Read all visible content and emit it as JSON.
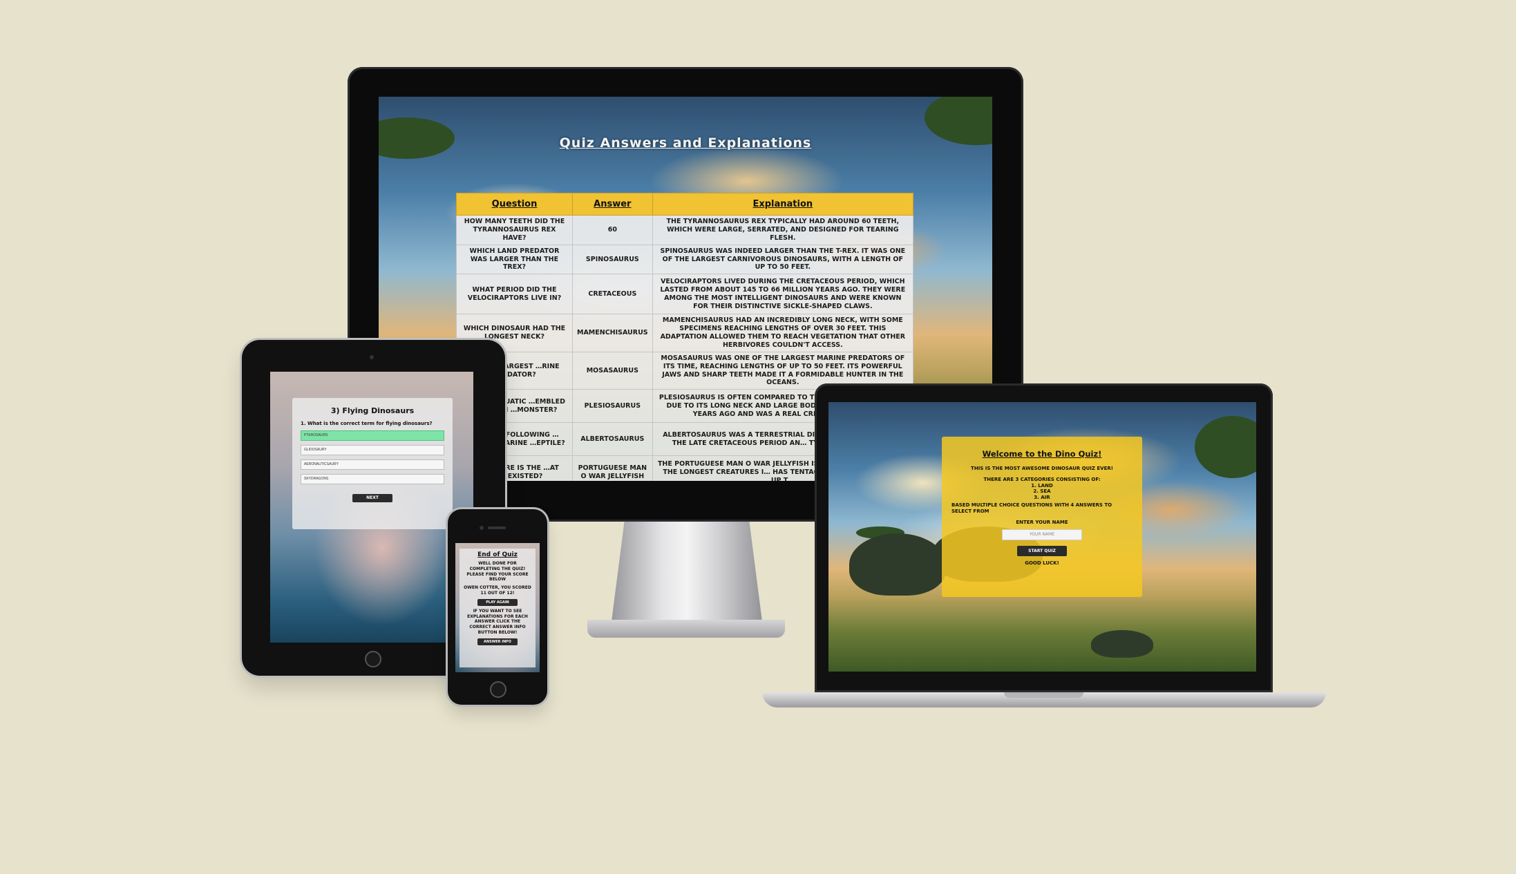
{
  "monitor": {
    "page_title": "Quiz Answers and Explanations",
    "columns": [
      "Question",
      "Answer",
      "Explanation"
    ],
    "rows": [
      {
        "question": "How many teeth did the Tyrannosaurus Rex have?",
        "answer": "60",
        "explanation": "The Tyrannosaurus Rex typically had around 60 teeth, which were large, serrated, and designed for tearing flesh."
      },
      {
        "question": "Which land predator was larger than the Trex?",
        "answer": "Spinosaurus",
        "explanation": "Spinosaurus was indeed larger than the T-Rex. It was one of the largest carnivorous dinosaurs, with a length of up to 50 feet."
      },
      {
        "question": "What period did the velociraptors live in?",
        "answer": "Cretaceous",
        "explanation": "Velociraptors lived during the Cretaceous period, which lasted from about 145 to 66 million years ago. They were among the most intelligent dinosaurs and were known for their distinctive sickle-shaped claws."
      },
      {
        "question": "Which dinosaur had the longest neck?",
        "answer": "Mamenchisaurus",
        "explanation": "Mamenchisaurus had an incredibly long neck, with some specimens reaching lengths of over 30 feet. This adaptation allowed them to reach vegetation that other herbivores couldn't access."
      },
      {
        "question": "…s the largest …rine predator?",
        "answer": "Mosasaurus",
        "explanation": "Mosasaurus was one of the largest marine predators of its time, reaching lengths of up to 50 feet. Its powerful jaws and sharp teeth made it a formidable hunter in the oceans."
      },
      {
        "question": "…cient aquatic …embled the Loch …monster?",
        "answer": "Plesiosaurus",
        "explanation": "Plesiosaurus is often compared to the Loch Ness Monster due to its long neck and large body. However, Plesio… years ago and was a real creature, livin…"
      },
      {
        "question": "…of the following …ancient marine …eptile?",
        "answer": "Albertosaurus",
        "explanation": "Albertosaurus was a terrestrial dinosau… lived during the Late Cretaceous period an… Tyrannosaurus re…"
      },
      {
        "question": "…creature is the …at ever existed?",
        "answer": "Portuguese Man O War Jellyfish",
        "explanation": "The Portuguese Man O War Jellyfish is … considered one of the longest creatures i… has tentacles that can extend up t…"
      }
    ]
  },
  "tablet": {
    "heading": "3) Flying Dinosaurs",
    "question": "1. What is the correct term for flying dinosaurs?",
    "options": [
      "Pterosaurs",
      "Glidosaury",
      "Aeronauticsaury",
      "Skydragons"
    ],
    "next_label": "Next"
  },
  "phone": {
    "heading": "End of Quiz",
    "message": "Well done for completing the quiz! Please find your score below",
    "score_text": "Owen Cotter, you scored 11 out of 12!",
    "play_again_label": "Play Again",
    "info_text": "If you want to see explanations for each answer click the correct answer info button below!",
    "answer_info_label": "Answer Info"
  },
  "laptop": {
    "heading": "Welcome to the Dino Quiz!",
    "intro": "This is the most awesome dinosaur quiz ever!",
    "categories_intro": "There are 3 categories consisting of:",
    "categories": [
      "1. Land",
      "2. Sea",
      "3. Air"
    ],
    "format_text": "Based multiple choice questions with 4 answers to select from",
    "name_label": "Enter your name",
    "name_placeholder": "Your name",
    "start_label": "Start Quiz",
    "good_luck": "Good Luck!"
  },
  "colors": {
    "page_background": "#e6e2cc",
    "header_yellow": "#f1c232",
    "correct_green": "#7de3a7",
    "button_dark": "#2b2b2b"
  }
}
